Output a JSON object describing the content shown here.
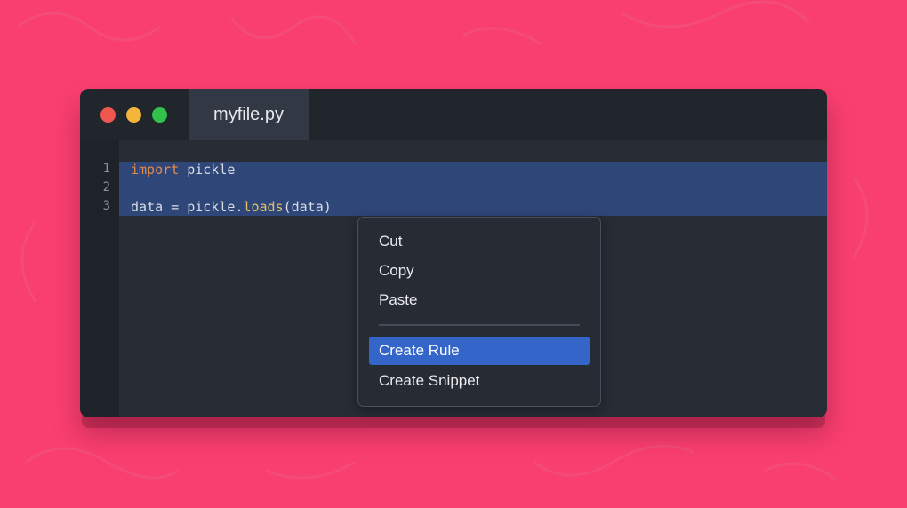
{
  "window": {
    "tab_title": "myfile.py"
  },
  "editor": {
    "line_numbers": [
      "1",
      "2",
      "3"
    ],
    "lines": [
      {
        "keyword": "import",
        "rest": " pickle"
      },
      {
        "text": ""
      },
      {
        "pre": "data = pickle.",
        "fn": "loads",
        "post": "(data)"
      }
    ]
  },
  "context_menu": {
    "items": [
      "Cut",
      "Copy",
      "Paste"
    ],
    "actions": [
      "Create Rule",
      "Create Snippet"
    ],
    "active_item": "Create Rule"
  },
  "colors": {
    "background": "#f93f6f",
    "window": "#252a33",
    "selection": "#2f4679",
    "menu_highlight": "#3465c9",
    "close": "#f0584f",
    "minimize": "#f5b43a",
    "maximize": "#30c24a"
  }
}
